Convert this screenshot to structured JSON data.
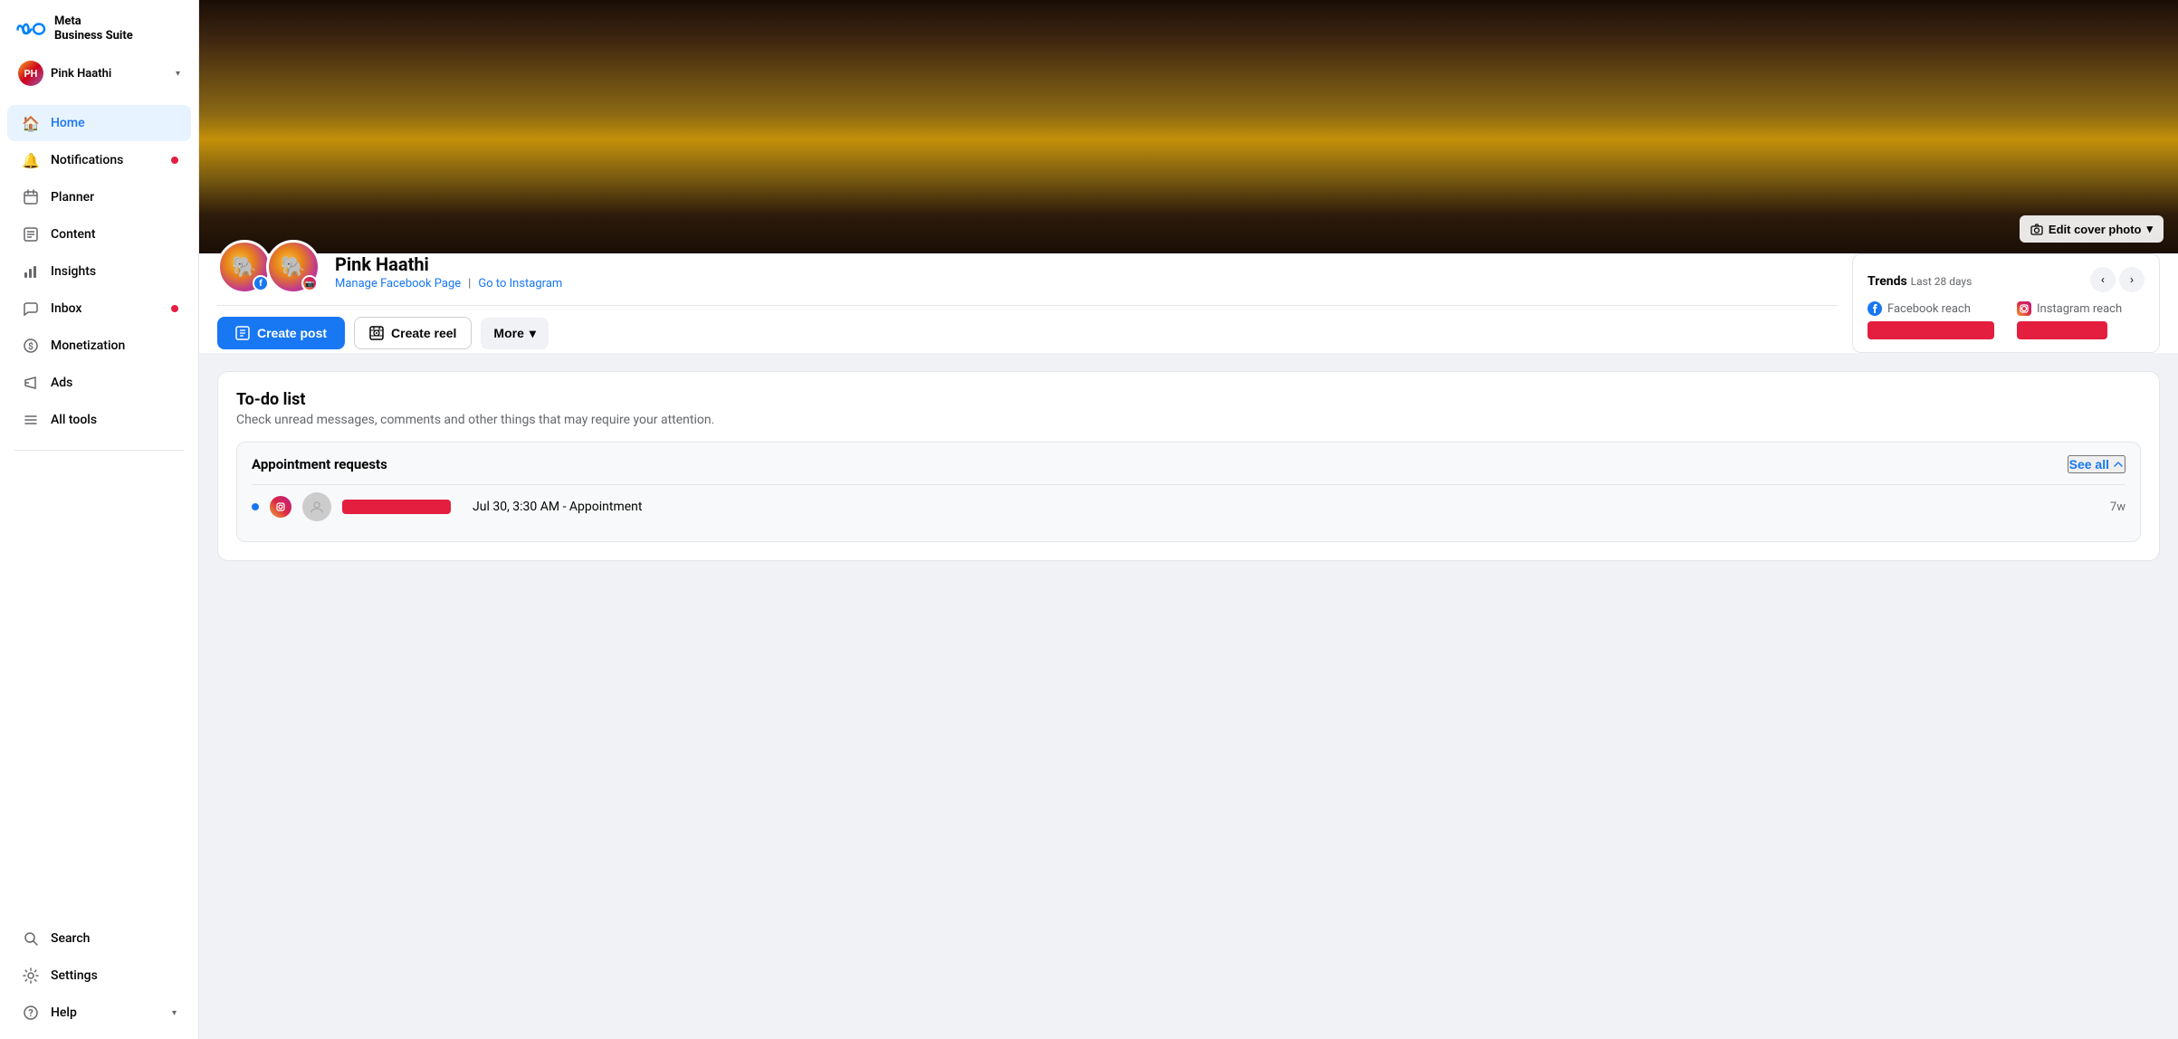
{
  "sidebar": {
    "logo_text": "Meta\nBusiness Suite",
    "account": {
      "name": "Pink Haathi",
      "initials": "PH"
    },
    "nav_items": [
      {
        "id": "home",
        "label": "Home",
        "icon": "🏠",
        "active": true,
        "badge": false
      },
      {
        "id": "notifications",
        "label": "Notifications",
        "icon": "🔔",
        "active": false,
        "badge": true
      },
      {
        "id": "planner",
        "label": "Planner",
        "icon": "📅",
        "active": false,
        "badge": false
      },
      {
        "id": "content",
        "label": "Content",
        "icon": "📄",
        "active": false,
        "badge": false
      },
      {
        "id": "insights",
        "label": "Insights",
        "icon": "📊",
        "active": false,
        "badge": false
      },
      {
        "id": "inbox",
        "label": "Inbox",
        "icon": "💬",
        "active": false,
        "badge": true
      },
      {
        "id": "monetization",
        "label": "Monetization",
        "icon": "💰",
        "active": false,
        "badge": false
      },
      {
        "id": "ads",
        "label": "Ads",
        "icon": "📢",
        "active": false,
        "badge": false
      },
      {
        "id": "all_tools",
        "label": "All tools",
        "icon": "≡",
        "active": false,
        "badge": false
      }
    ],
    "bottom_items": [
      {
        "id": "search",
        "label": "Search",
        "icon": "🔍"
      },
      {
        "id": "settings",
        "label": "Settings",
        "icon": "⚙️"
      },
      {
        "id": "help",
        "label": "Help",
        "icon": "❓",
        "has_chevron": true
      }
    ]
  },
  "profile": {
    "name": "Pink Haathi",
    "manage_fb_label": "Manage Facebook Page",
    "go_to_ig_label": "Go to Instagram",
    "separator": "|"
  },
  "cover": {
    "edit_label": "Edit cover photo"
  },
  "actions": {
    "create_post_label": "Create post",
    "create_reel_label": "Create reel",
    "more_label": "More"
  },
  "trends": {
    "title": "Trends",
    "period": "Last 28 days",
    "fb_reach_label": "Facebook reach",
    "ig_reach_label": "Instagram reach"
  },
  "todo": {
    "title": "To-do list",
    "subtitle": "Check unread messages, comments and other things that may require your attention.",
    "card": {
      "title": "Appointment requests",
      "see_all_label": "See all",
      "appointment": {
        "details": "Jul 30, 3:30 AM - Appointment",
        "time": "7w"
      }
    }
  }
}
